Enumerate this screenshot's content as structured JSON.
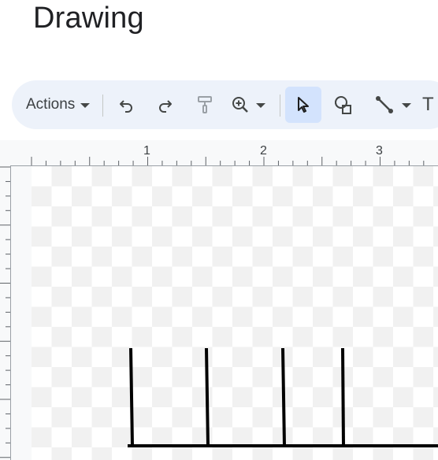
{
  "header": {
    "title": "Drawing"
  },
  "toolbar": {
    "actions_label": "Actions",
    "buttons": [
      {
        "name": "undo-button",
        "icon": "undo-icon"
      },
      {
        "name": "redo-button",
        "icon": "redo-icon"
      },
      {
        "name": "paint-format-button",
        "icon": "paint-roller-icon"
      },
      {
        "name": "zoom-button",
        "icon": "zoom-in-icon"
      },
      {
        "name": "select-button",
        "icon": "cursor-arrow-icon",
        "selected": true
      },
      {
        "name": "shape-button",
        "icon": "shape-icon"
      },
      {
        "name": "line-button",
        "icon": "line-icon"
      },
      {
        "name": "text-box-button",
        "icon": "text-icon"
      }
    ],
    "text_tool_glyph": "T"
  },
  "ruler": {
    "top_numbers": [
      "1",
      "2",
      "3"
    ]
  },
  "colors": {
    "toolbar_bg": "#edf2fa",
    "selected_bg": "#d3e3fd",
    "stroke": "#000000"
  }
}
